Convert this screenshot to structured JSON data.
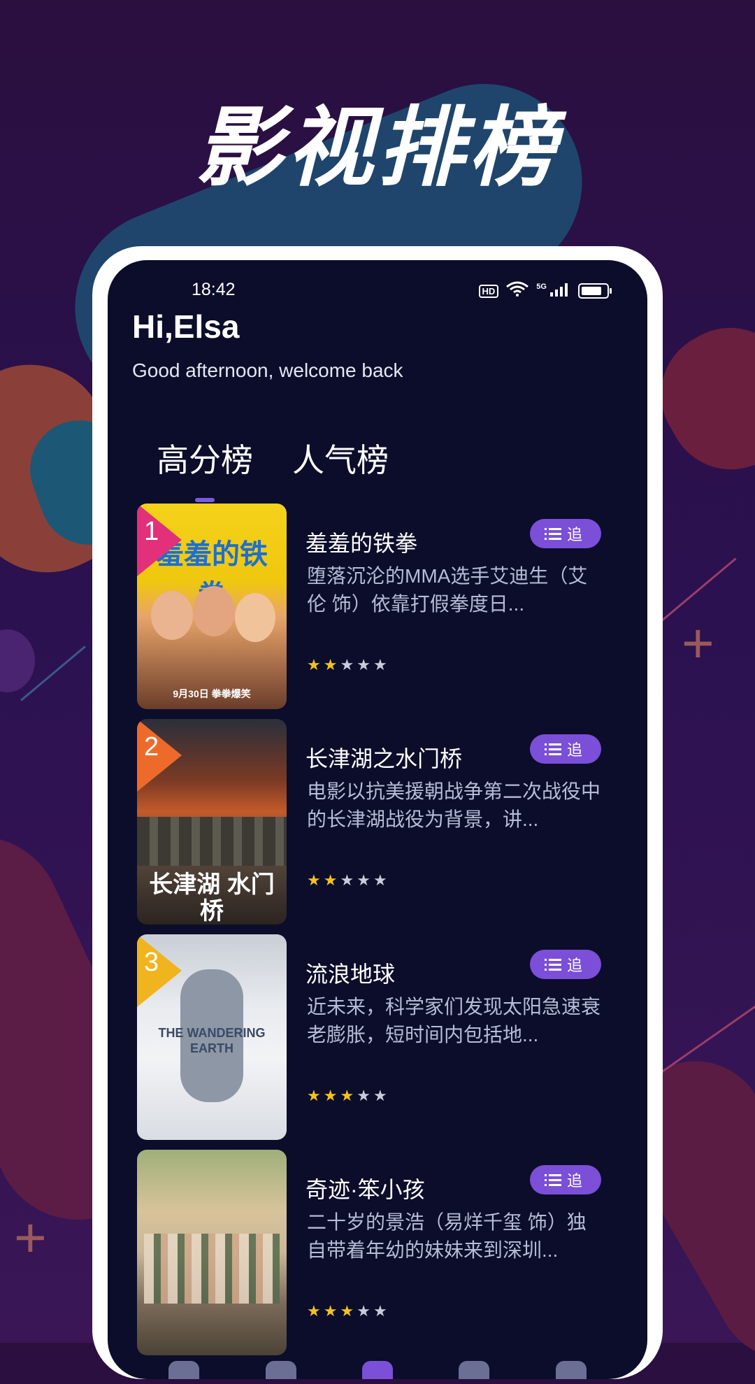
{
  "headline": "影视排榜",
  "status": {
    "time": "18:42",
    "hd": "HD",
    "network": "5G"
  },
  "greeting": "Hi,Elsa",
  "subgreeting": "Good afternoon, welcome back",
  "tabs": [
    {
      "label": "高分榜",
      "active": true
    },
    {
      "label": "人气榜",
      "active": false
    }
  ],
  "follow_label": "追",
  "movies": [
    {
      "rank": "1",
      "title": "羞羞的铁拳",
      "poster_text": "羞羞的铁拳",
      "poster_date": "9月30日 拳拳爆笑",
      "description": "堕落沉沦的MMA选手艾迪生（艾伦 饰）依靠打假拳度日...",
      "rating": 2,
      "rank_color": "#e2307a"
    },
    {
      "rank": "2",
      "title": "长津湖之水门桥",
      "poster_text": "长津湖 水门桥",
      "description": "电影以抗美援朝战争第二次战役中的长津湖战役为背景，讲...",
      "rating": 2,
      "rank_color": "#ee6a2b"
    },
    {
      "rank": "3",
      "title": "流浪地球",
      "poster_text": "THE WANDERING EARTH",
      "description": "近未来，科学家们发现太阳急速衰老膨胀，短时间内包括地...",
      "rating": 3,
      "rank_color": "#f0b41f"
    },
    {
      "rank": "",
      "title": "奇迹·笨小孩",
      "poster_text": "",
      "description": "二十岁的景浩（易烊千玺 饰）独自带着年幼的妹妹来到深圳...",
      "rating": 3,
      "rank_color": ""
    }
  ]
}
